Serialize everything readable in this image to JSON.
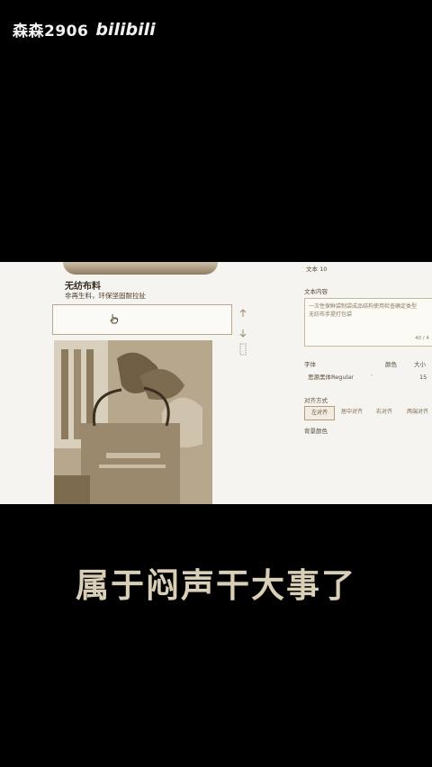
{
  "watermark": {
    "user": "森森2906",
    "logo": "bilibili"
  },
  "editor": {
    "product_title": "无纺布料",
    "product_subtitle": "非再生料，环保坚固耐拉扯",
    "text_label": "文本 10",
    "content_label": "文本内容",
    "content_value": "一次性保鲜袋制袋成品结构使用检查确定类型",
    "content_value_line2": "无纺布手提打包袋",
    "char_count": "40 / 4",
    "font_label": "字体",
    "color_label": "颜色",
    "size_label": "大小",
    "font_value": "思源黑体Regular",
    "size_value": "15",
    "align_label": "对齐方式",
    "align_options": [
      "左对齐",
      "居中对齐",
      "右对齐",
      "两端对齐"
    ],
    "bg_color_label": "背景颜色",
    "colors": {
      "accent": "#b89a76",
      "text": "#5a4a36",
      "panel_bg": "#f5f4f0"
    }
  },
  "caption": "属于闷声干大事了"
}
